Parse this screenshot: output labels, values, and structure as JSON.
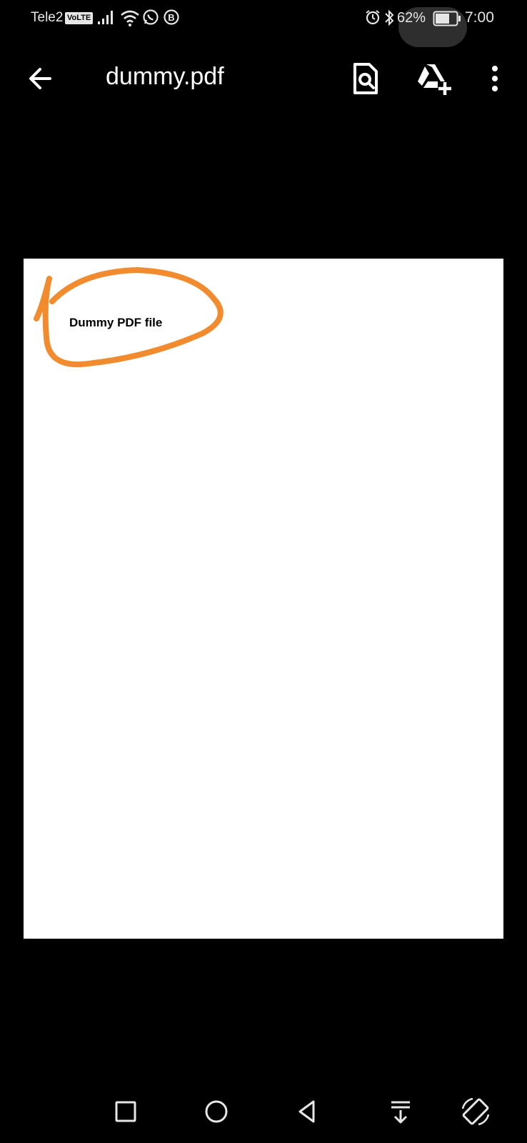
{
  "status_bar": {
    "carrier": "Tele2",
    "volte": "VoLTE",
    "battery_percent": "62%",
    "time": "7:00",
    "icons": [
      "signal-icon",
      "wifi-icon",
      "whatsapp-icon",
      "b-badge-icon",
      "alarm-icon",
      "bluetooth-icon",
      "battery-icon"
    ]
  },
  "app_bar": {
    "title": "dummy.pdf",
    "actions": [
      "back-arrow-icon",
      "find-in-page-icon",
      "add-to-drive-icon",
      "more-vert-icon"
    ]
  },
  "document": {
    "text": "Dummy PDF file",
    "annotation_color": "#f28a2e"
  },
  "nav_bar": {
    "icons": [
      "recents-square-icon",
      "home-circle-icon",
      "back-triangle-icon",
      "notifications-down-icon",
      "rotate-screen-icon"
    ]
  }
}
